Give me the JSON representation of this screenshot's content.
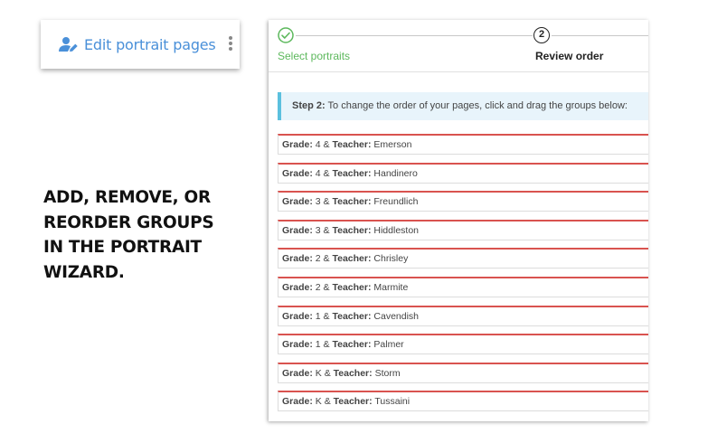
{
  "edit_button": {
    "label": "Edit portrait pages",
    "icon": "person-edit-icon",
    "color": "#4a90d9"
  },
  "menu": {
    "icon": "kebab-menu-icon"
  },
  "headline": {
    "lines": [
      "ADD, REMOVE, OR",
      "REORDER GROUPS",
      "IN THE PORTRAIT",
      "WIZARD."
    ]
  },
  "wizard": {
    "steps": [
      {
        "number": "",
        "label": "Select portraits",
        "status": "complete",
        "icon": "check-circle-icon",
        "color": "#5cb85c"
      },
      {
        "number": "2",
        "label": "Review order",
        "status": "active"
      }
    ],
    "info": {
      "prefix": "Step 2:",
      "text": "To change the order of your pages, click and drag the groups below:"
    },
    "group_keys": {
      "grade": "Grade:",
      "joiner": "&",
      "teacher": "Teacher:"
    },
    "groups": [
      {
        "grade": "4",
        "teacher": "Emerson"
      },
      {
        "grade": "4",
        "teacher": "Handinero"
      },
      {
        "grade": "3",
        "teacher": "Freundlich"
      },
      {
        "grade": "3",
        "teacher": "Hiddleston"
      },
      {
        "grade": "2",
        "teacher": "Chrisley"
      },
      {
        "grade": "2",
        "teacher": "Marmite"
      },
      {
        "grade": "1",
        "teacher": "Cavendish"
      },
      {
        "grade": "1",
        "teacher": "Palmer"
      },
      {
        "grade": "K",
        "teacher": "Storm"
      },
      {
        "grade": "K",
        "teacher": "Tussaini"
      }
    ],
    "row_accent_color": "#d9534f",
    "info_accent_color": "#5bc0de"
  }
}
